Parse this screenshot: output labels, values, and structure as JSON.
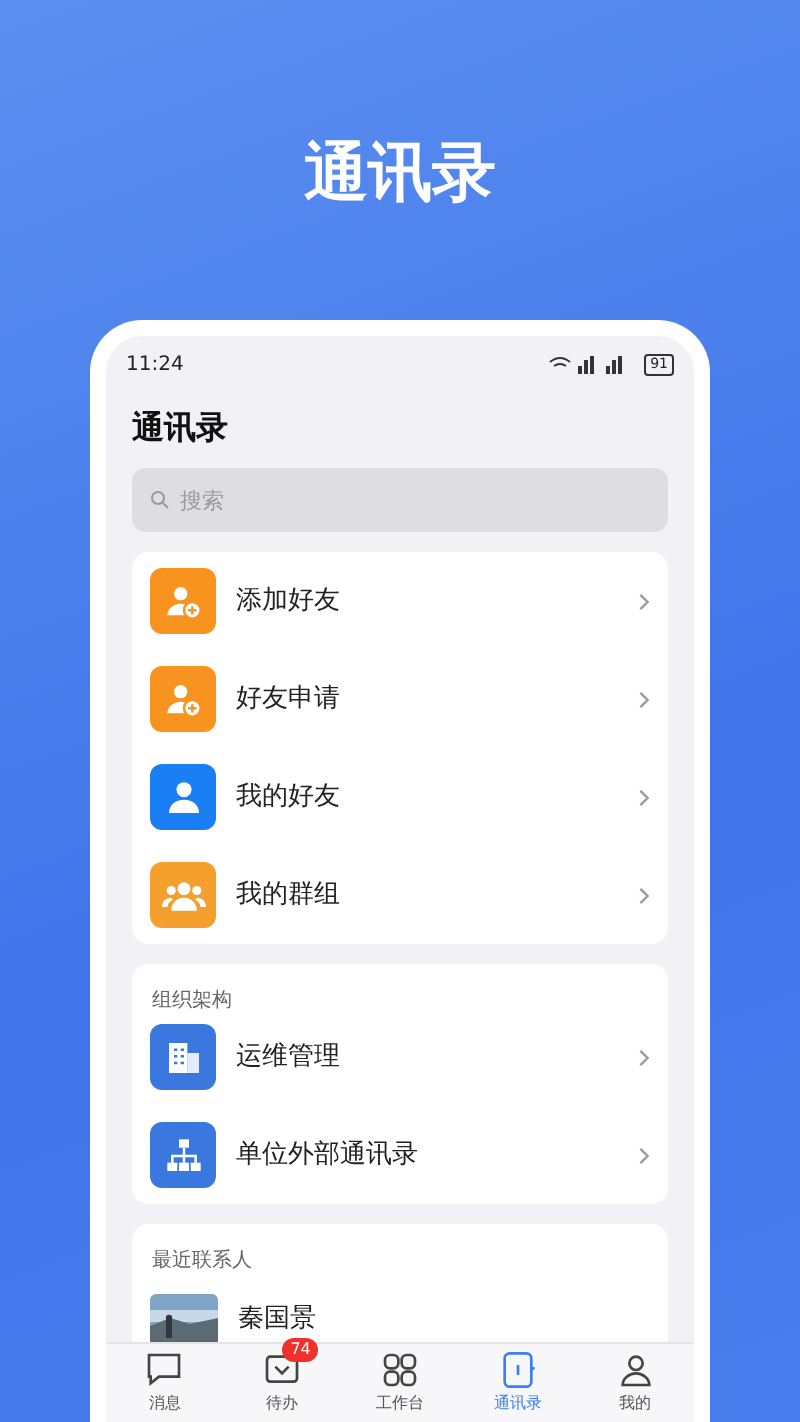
{
  "headline": "通讯录",
  "status_bar": {
    "time": "11:24",
    "battery": "91"
  },
  "screen_title": "通讯录",
  "search": {
    "placeholder": "搜索"
  },
  "menu": [
    {
      "label": "添加好友",
      "kind": "add-user",
      "color": "#f7931e"
    },
    {
      "label": "好友申请",
      "kind": "add-user",
      "color": "#f7931e"
    },
    {
      "label": "我的好友",
      "kind": "user",
      "color": "#1a7ff5"
    },
    {
      "label": "我的群组",
      "kind": "group",
      "color": "#f59f2c"
    }
  ],
  "organization": {
    "title": "组织架构",
    "items": [
      {
        "label": "运维管理",
        "kind": "building"
      },
      {
        "label": "单位外部通讯录",
        "kind": "org"
      }
    ]
  },
  "recent": {
    "title": "最近联系人",
    "contacts": [
      {
        "name": "秦国景"
      }
    ]
  },
  "tab_bar": [
    {
      "label": "消息",
      "kind": "chat",
      "selected": false
    },
    {
      "label": "待办",
      "kind": "todo",
      "selected": false,
      "badge": "74"
    },
    {
      "label": "工作台",
      "kind": "grid",
      "selected": false
    },
    {
      "label": "通讯录",
      "kind": "book",
      "selected": true
    },
    {
      "label": "我的",
      "kind": "me",
      "selected": false
    }
  ]
}
